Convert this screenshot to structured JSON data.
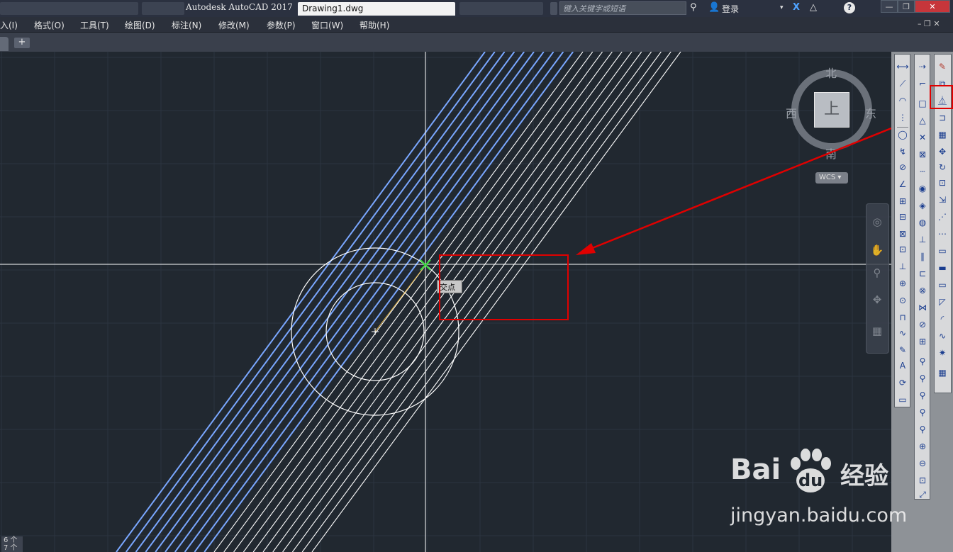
{
  "titlebar": {
    "app_title": "Autodesk AutoCAD 2017",
    "doc_tab": "Drawing1.dwg",
    "search_placeholder": "键入关键字或短语",
    "login_label": "登录",
    "help_icon": "?",
    "win_min": "—",
    "win_restore": "❐",
    "win_close": "✕"
  },
  "menubar": {
    "items": [
      {
        "label": "入(I)"
      },
      {
        "label": "格式(O)"
      },
      {
        "label": "工具(T)"
      },
      {
        "label": "绘图(D)"
      },
      {
        "label": "标注(N)"
      },
      {
        "label": "修改(M)"
      },
      {
        "label": "参数(P)"
      },
      {
        "label": "窗口(W)"
      },
      {
        "label": "帮助(H)"
      }
    ],
    "doc_controls": "– ❐ ✕"
  },
  "tabbar": {
    "add_label": "+"
  },
  "viewcube": {
    "north": "北",
    "south": "南",
    "east": "东",
    "west": "西",
    "face": "上",
    "wcs": "WCS ▾"
  },
  "snap_tooltip": "交点",
  "status": {
    "line1": "6 个",
    "line2": "7 个"
  },
  "watermark": {
    "brand": "Bai",
    "brand2": "du",
    "cn": "经验",
    "url": "jingyan.baidu.com"
  },
  "colors": {
    "canvas_bg": "#212830",
    "grid": "#2c3440",
    "selected_line": "#7aa7ff",
    "line": "#ffffff",
    "crosshair": "#ffffff",
    "snap_marker": "#39d93c",
    "highlight": "#e00000"
  },
  "icons": {
    "search": "binoculars-icon",
    "user": "user-icon",
    "exchange": "x-exchange-icon",
    "a360": "a360-icon",
    "help": "help-icon",
    "mirror_tool": "mirror-icon",
    "nav_wheel": "steering-wheel-icon",
    "pan": "pan-hand-icon",
    "zoom": "zoom-icon",
    "orbit": "orbit-icon",
    "showmotion": "showmotion-icon"
  }
}
